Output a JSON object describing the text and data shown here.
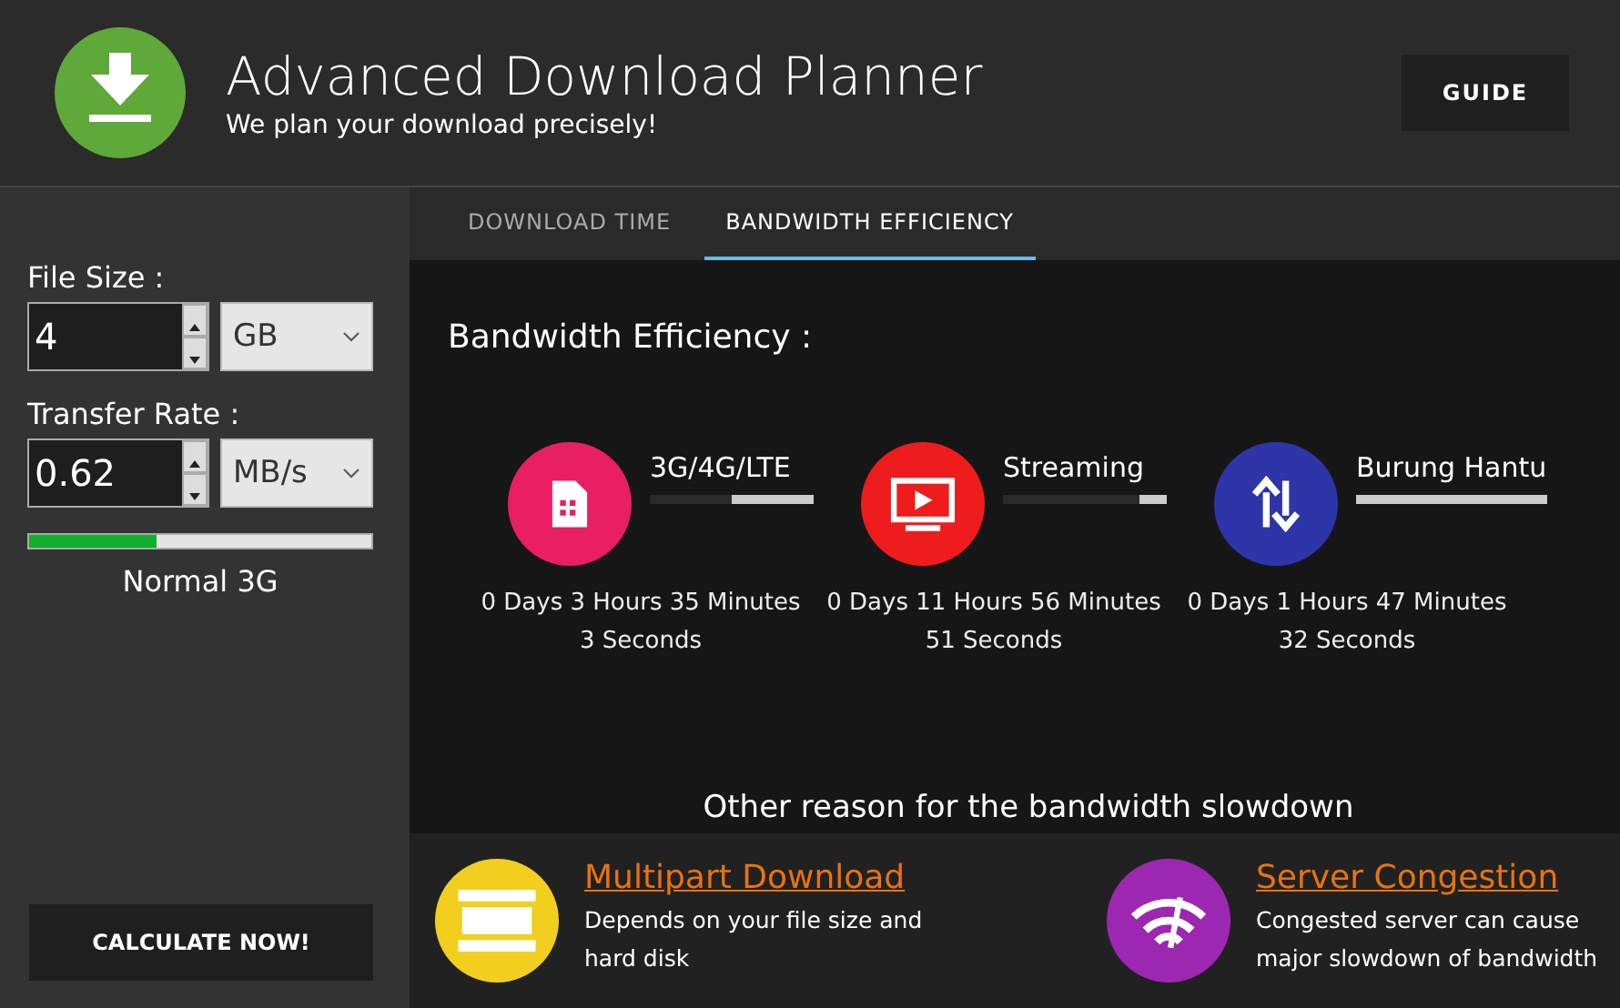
{
  "header": {
    "title": "Advanced Download Planner",
    "subtitle": "We plan your download precisely!",
    "guide_button": "GUIDE"
  },
  "sidebar": {
    "fields": [
      {
        "label": "File Size :",
        "value": "4",
        "unit": "GB"
      },
      {
        "label": "Transfer Rate :",
        "value": "0.62",
        "unit": "MB/s"
      }
    ],
    "speed_meter": {
      "level": 0.37,
      "label": "Normal 3G"
    },
    "calculate_button": "CALCULATE NOW!"
  },
  "tabs": [
    {
      "label": "DOWNLOAD TIME",
      "selected": false
    },
    {
      "label": "BANDWIDTH EFFICIENCY",
      "selected": true
    }
  ],
  "efficiency": {
    "title": "Bandwidth Efficiency :",
    "items": [
      {
        "kind": "sim",
        "color": "#e91e63",
        "name": "3G/4G/LTE",
        "level": 0.5,
        "time": "0 Days 3 Hours 35 Minutes 3 Seconds"
      },
      {
        "kind": "tv",
        "color": "#ee1c1c",
        "name": "Streaming",
        "level": 0.17,
        "time": "0 Days 11 Hours 56 Minutes 51 Seconds"
      },
      {
        "kind": "arrows",
        "color": "#2e35a8",
        "name": "Burung Hantu",
        "level": 1,
        "time": "0 Days 1 Hours 47 Minutes 32 Seconds"
      }
    ]
  },
  "reasons": {
    "heading": "Other reason for the bandwidth slowdown",
    "items": [
      {
        "kind": "layers",
        "color": "#f2cf1f",
        "title": "Multipart Download",
        "text": "Depends on your file size and hard disk"
      },
      {
        "kind": "wifi",
        "color": "#9c27b0",
        "title": "Server Congestion",
        "text": "Congested server can cause major slowdown of bandwidth"
      }
    ]
  }
}
